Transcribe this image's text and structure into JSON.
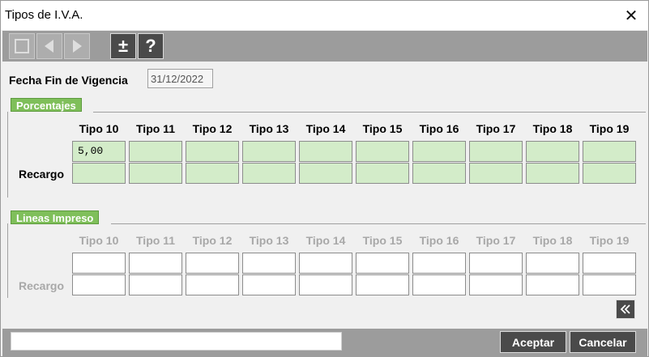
{
  "window": {
    "title": "Tipos de I.V.A.",
    "close_glyph": "✕"
  },
  "toolbar": {
    "buttons": [
      {
        "icon": "square-icon"
      },
      {
        "icon": "triangle-left-icon"
      },
      {
        "icon": "triangle-right-icon"
      },
      {
        "icon": "plus-minus-icon",
        "glyph": "±"
      },
      {
        "icon": "help-icon",
        "glyph": "?"
      }
    ]
  },
  "fecha": {
    "label": "Fecha Fin de Vigencia",
    "value": "31/12/2022"
  },
  "porcentajes": {
    "title": "Porcentajes",
    "columns": [
      "Tipo 10",
      "Tipo 11",
      "Tipo 12",
      "Tipo 13",
      "Tipo 14",
      "Tipo 15",
      "Tipo 16",
      "Tipo 17",
      "Tipo 18",
      "Tipo 19"
    ],
    "values": [
      "5,00",
      "",
      "",
      "",
      "",
      "",
      "",
      "",
      "",
      ""
    ],
    "recargo_label": "Recargo",
    "recargo": [
      "",
      "",
      "",
      "",
      "",
      "",
      "",
      "",
      "",
      ""
    ]
  },
  "lineas": {
    "title": "Lineas Impreso",
    "columns": [
      "Tipo 10",
      "Tipo 11",
      "Tipo 12",
      "Tipo 13",
      "Tipo 14",
      "Tipo 15",
      "Tipo 16",
      "Tipo 17",
      "Tipo 18",
      "Tipo 19"
    ],
    "values": [
      "",
      "",
      "",
      "",
      "",
      "",
      "",
      "",
      "",
      ""
    ],
    "recargo_label": "Recargo",
    "recargo": [
      "",
      "",
      "",
      "",
      "",
      "",
      "",
      "",
      "",
      ""
    ]
  },
  "collapse_glyph": "«",
  "footer": {
    "status": "",
    "accept_label": "Aceptar",
    "cancel_label": "Cancelar"
  },
  "colors": {
    "accent_green": "#7fbf5a",
    "cell_green": "#d3ecc9",
    "toolbar_gray": "#9c9c9c",
    "button_dark": "#4a4a4a"
  }
}
